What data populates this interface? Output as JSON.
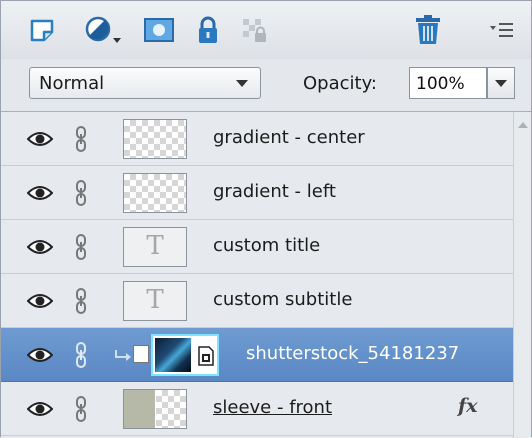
{
  "toolbar": {
    "icons": [
      "new-layer-icon",
      "adjustment-layer-icon",
      "layer-mask-icon",
      "lock-all-icon",
      "lock-transparency-icon",
      "delete-layer-icon",
      "panel-menu-icon"
    ],
    "accent": "#2a7fbf"
  },
  "mode": {
    "blend_value": "Normal",
    "opacity_label": "Opacity:",
    "opacity_value": "100%"
  },
  "layers": [
    {
      "name": "gradient - center",
      "thumb": "transparent"
    },
    {
      "name": "gradient - left",
      "thumb": "transparent"
    },
    {
      "name": "custom title",
      "thumb": "text",
      "thumb_glyph": "T"
    },
    {
      "name": "custom subtitle",
      "thumb": "text",
      "thumb_glyph": "T"
    },
    {
      "name": "shutterstock_54181237",
      "thumb": "smart-object",
      "selected": true
    },
    {
      "name": "sleeve - front",
      "thumb": "sleeve",
      "fx": "fx"
    }
  ],
  "colors": {
    "selected_row": "#5f8ec9",
    "selected_text": "#ffffff",
    "thumb_highlight": "#7fe4ff"
  }
}
